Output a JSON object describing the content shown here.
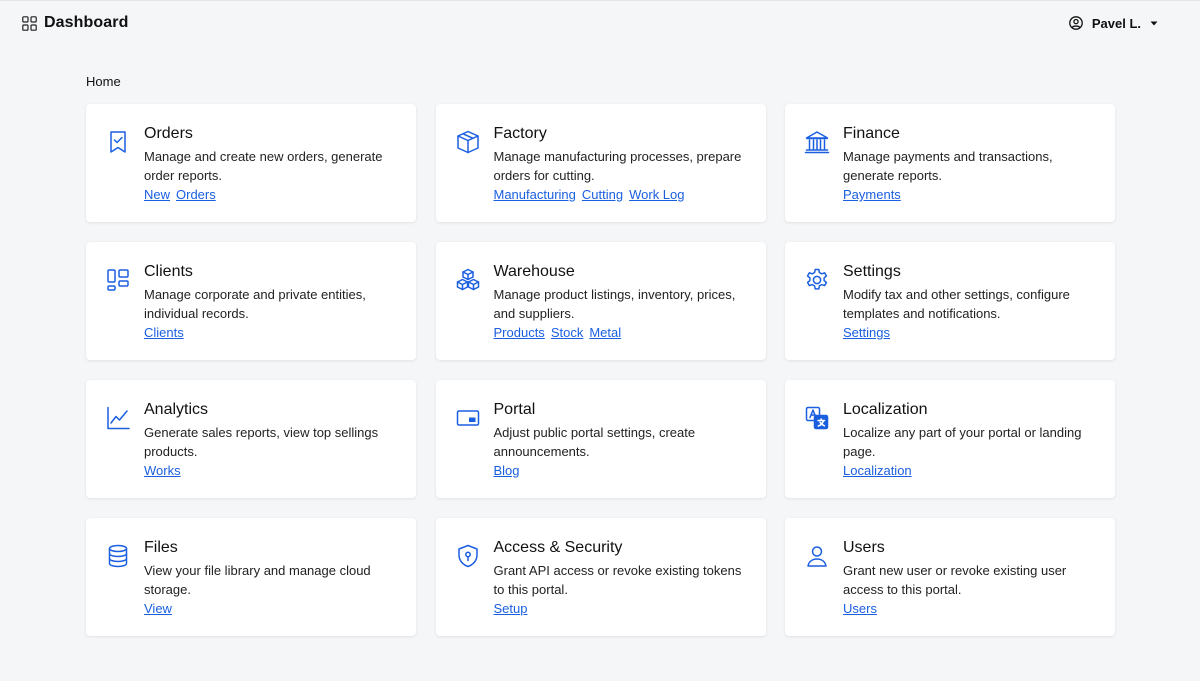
{
  "header": {
    "title": "Dashboard",
    "user_name": "Pavel L."
  },
  "breadcrumb": "Home",
  "accent_color": "#1a5fe0",
  "cards": [
    {
      "title": "Orders",
      "icon": "bookmark-check-icon",
      "description": "Manage and create new orders, generate order reports.",
      "links": [
        "New",
        "Orders"
      ]
    },
    {
      "title": "Factory",
      "icon": "box-icon",
      "description": "Manage manufacturing processes, prepare orders for cutting.",
      "links": [
        "Manufacturing",
        "Cutting",
        "Work Log"
      ]
    },
    {
      "title": "Finance",
      "icon": "bank-icon",
      "description": "Manage payments and transactions, generate reports.",
      "links": [
        "Payments"
      ]
    },
    {
      "title": "Clients",
      "icon": "layout-blocks-icon",
      "description": "Manage corporate and private entities, individual records.",
      "links": [
        "Clients"
      ]
    },
    {
      "title": "Warehouse",
      "icon": "boxes-icon",
      "description": "Manage product listings, inventory, prices, and suppliers.",
      "links": [
        "Products",
        "Stock",
        "Metal"
      ]
    },
    {
      "title": "Settings",
      "icon": "gear-icon",
      "description": "Modify tax and other settings, configure templates and notifications.",
      "links": [
        "Settings"
      ]
    },
    {
      "title": "Analytics",
      "icon": "line-chart-icon",
      "description": "Generate sales reports, view top sellings products.",
      "links": [
        "Works"
      ]
    },
    {
      "title": "Portal",
      "icon": "window-icon",
      "description": "Adjust public portal settings, create announcements.",
      "links": [
        "Blog"
      ]
    },
    {
      "title": "Localization",
      "icon": "translate-icon",
      "description": "Localize any part of your portal or landing page.",
      "links": [
        "Localization"
      ]
    },
    {
      "title": "Files",
      "icon": "database-icon",
      "description": "View your file library and manage cloud storage.",
      "links": [
        "View"
      ]
    },
    {
      "title": "Access & Security",
      "icon": "shield-lock-icon",
      "description": "Grant API access or revoke existing tokens to this portal.",
      "links": [
        "Setup"
      ]
    },
    {
      "title": "Users",
      "icon": "user-icon",
      "description": "Grant new user or revoke existing user access to this portal.",
      "links": [
        "Users"
      ]
    }
  ]
}
